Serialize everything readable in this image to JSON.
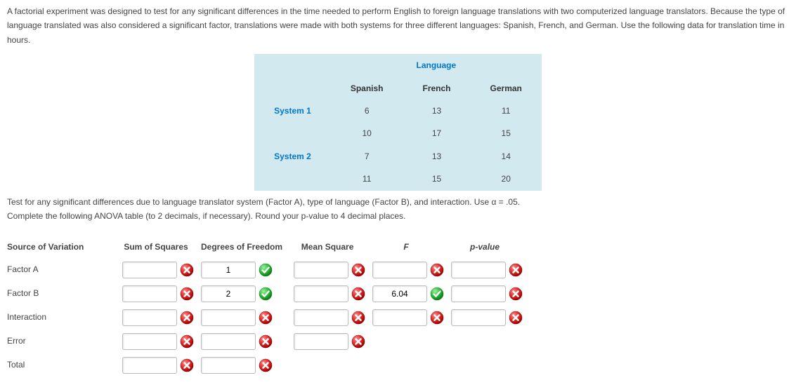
{
  "intro": "A factorial experiment was designed to test for any significant differences in the time needed to perform English to foreign language translations with two computerized language translators. Because the type of language translated was also considered a significant factor, translations were made with both systems for three different languages: Spanish, French, and German. Use the following data for translation time in hours.",
  "dataTable": {
    "superHeader": "Language",
    "cols": [
      "Spanish",
      "French",
      "German"
    ],
    "rowLabels": [
      "System 1",
      "System 2"
    ],
    "rows": [
      [
        [
          "6",
          "10"
        ],
        [
          "13",
          "17"
        ],
        [
          "11",
          "15"
        ]
      ],
      [
        [
          "7",
          "11"
        ],
        [
          "13",
          "15"
        ],
        [
          "14",
          "20"
        ]
      ]
    ]
  },
  "testLine": "Test for any significant differences due to language translator system (Factor A), type of language (Factor B), and interaction. Use α = .05.",
  "completeLine": "Complete the following ANOVA table (to 2 decimals, if necessary). Round your p-value to 4 decimal places.",
  "anova": {
    "headers": [
      "Source of Variation",
      "Sum of Squares",
      "Degrees of Freedom",
      "Mean Square",
      "F",
      "p-value"
    ],
    "rows": [
      {
        "label": "Factor A",
        "ss": {
          "v": "",
          "m": "wrong"
        },
        "df": {
          "v": "1",
          "m": "right"
        },
        "ms": {
          "v": "",
          "m": "wrong"
        },
        "f": {
          "v": "",
          "m": "wrong"
        },
        "p": {
          "v": "",
          "m": "wrong"
        }
      },
      {
        "label": "Factor B",
        "ss": {
          "v": "",
          "m": "wrong"
        },
        "df": {
          "v": "2",
          "m": "right"
        },
        "ms": {
          "v": "",
          "m": "wrong"
        },
        "f": {
          "v": "6.04",
          "m": "right"
        },
        "p": {
          "v": "",
          "m": "wrong"
        }
      },
      {
        "label": "Interaction",
        "ss": {
          "v": "",
          "m": "wrong"
        },
        "df": {
          "v": "",
          "m": "wrong"
        },
        "ms": {
          "v": "",
          "m": "wrong"
        },
        "f": {
          "v": "",
          "m": "wrong"
        },
        "p": {
          "v": "",
          "m": "wrong"
        }
      },
      {
        "label": "Error",
        "ss": {
          "v": "",
          "m": "wrong"
        },
        "df": {
          "v": "",
          "m": "wrong"
        },
        "ms": {
          "v": "",
          "m": "wrong"
        }
      },
      {
        "label": "Total",
        "ss": {
          "v": "",
          "m": "wrong"
        },
        "df": {
          "v": "",
          "m": "wrong"
        }
      }
    ]
  },
  "chart_data": {
    "type": "table",
    "title": "Translation time in hours",
    "factors": {
      "A": "System",
      "B": "Language"
    },
    "levels": {
      "A": [
        "System 1",
        "System 2"
      ],
      "B": [
        "Spanish",
        "French",
        "German"
      ]
    },
    "replicates": 2,
    "data": {
      "System 1": {
        "Spanish": [
          6,
          10
        ],
        "French": [
          13,
          17
        ],
        "German": [
          11,
          15
        ]
      },
      "System 2": {
        "Spanish": [
          7,
          11
        ],
        "French": [
          13,
          15
        ],
        "German": [
          14,
          20
        ]
      }
    },
    "alpha": 0.05
  }
}
